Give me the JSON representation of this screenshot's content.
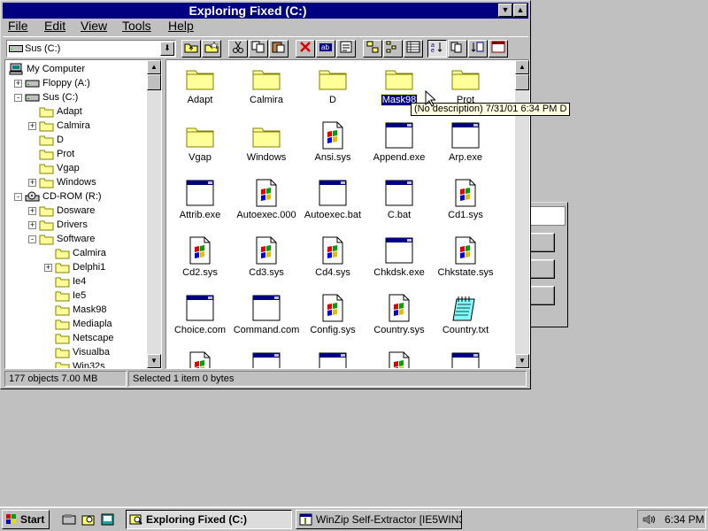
{
  "window": {
    "title": "Exploring Fixed (C:)",
    "menu": [
      "File",
      "Edit",
      "View",
      "Tools",
      "Help"
    ],
    "drive_combo": "Sus (C:)",
    "toolbar_buttons": [
      "up-one-level",
      "map-drive",
      "cut",
      "copy",
      "paste",
      "delete",
      "properties",
      "large-icons",
      "small-icons",
      "list",
      "details",
      "sort-name",
      "sort-type",
      "sort-size",
      "sort-date"
    ]
  },
  "tree": [
    {
      "label": "My Computer",
      "level": 0,
      "icon": "computer-icon",
      "toggle": ""
    },
    {
      "label": "Floppy (A:)",
      "level": 1,
      "icon": "floppy-drive-icon",
      "toggle": "+"
    },
    {
      "label": "Sus (C:)",
      "level": 1,
      "icon": "hard-drive-icon",
      "toggle": "-"
    },
    {
      "label": "Adapt",
      "level": 2,
      "icon": "folder-icon",
      "toggle": ""
    },
    {
      "label": "Calmira",
      "level": 2,
      "icon": "folder-icon",
      "toggle": "+"
    },
    {
      "label": "D",
      "level": 2,
      "icon": "folder-icon",
      "toggle": ""
    },
    {
      "label": "Prot",
      "level": 2,
      "icon": "folder-icon",
      "toggle": ""
    },
    {
      "label": "Vgap",
      "level": 2,
      "icon": "folder-icon",
      "toggle": ""
    },
    {
      "label": "Windows",
      "level": 2,
      "icon": "folder-icon",
      "toggle": "+"
    },
    {
      "label": "CD-ROM (R:)",
      "level": 1,
      "icon": "cdrom-icon",
      "toggle": "-"
    },
    {
      "label": "Dosware",
      "level": 2,
      "icon": "folder-icon",
      "toggle": "+"
    },
    {
      "label": "Drivers",
      "level": 2,
      "icon": "folder-icon",
      "toggle": "+"
    },
    {
      "label": "Software",
      "level": 2,
      "icon": "folder-icon",
      "toggle": "-"
    },
    {
      "label": "Calmira",
      "level": 3,
      "icon": "folder-icon",
      "toggle": ""
    },
    {
      "label": "Delphi1",
      "level": 3,
      "icon": "folder-icon",
      "toggle": "+"
    },
    {
      "label": "Ie4",
      "level": 3,
      "icon": "folder-icon",
      "toggle": ""
    },
    {
      "label": "Ie5",
      "level": 3,
      "icon": "folder-icon",
      "toggle": ""
    },
    {
      "label": "Mask98",
      "level": 3,
      "icon": "folder-icon",
      "toggle": ""
    },
    {
      "label": "Mediapla",
      "level": 3,
      "icon": "folder-icon",
      "toggle": ""
    },
    {
      "label": "Netscape",
      "level": 3,
      "icon": "folder-icon",
      "toggle": ""
    },
    {
      "label": "Visualba",
      "level": 3,
      "icon": "folder-icon",
      "toggle": ""
    },
    {
      "label": "Win32s",
      "level": 3,
      "icon": "folder-icon",
      "toggle": ""
    }
  ],
  "files": [
    {
      "name": "Adapt",
      "type": "folder"
    },
    {
      "name": "Calmira",
      "type": "folder"
    },
    {
      "name": "D",
      "type": "folder"
    },
    {
      "name": "Mask98",
      "type": "folder",
      "selected": true
    },
    {
      "name": "Prot",
      "type": "folder"
    },
    {
      "name": "Vgap",
      "type": "folder"
    },
    {
      "name": "Windows",
      "type": "folder"
    },
    {
      "name": "Ansi.sys",
      "type": "sys"
    },
    {
      "name": "Append.exe",
      "type": "exe"
    },
    {
      "name": "Arp.exe",
      "type": "exe"
    },
    {
      "name": "Attrib.exe",
      "type": "exe"
    },
    {
      "name": "Autoexec.000",
      "type": "sys"
    },
    {
      "name": "Autoexec.bat",
      "type": "exe"
    },
    {
      "name": "C.bat",
      "type": "exe"
    },
    {
      "name": "Cd1.sys",
      "type": "sys"
    },
    {
      "name": "Cd2.sys",
      "type": "sys"
    },
    {
      "name": "Cd3.sys",
      "type": "sys"
    },
    {
      "name": "Cd4.sys",
      "type": "sys"
    },
    {
      "name": "Chkdsk.exe",
      "type": "exe"
    },
    {
      "name": "Chkstate.sys",
      "type": "sys"
    },
    {
      "name": "Choice.com",
      "type": "exe"
    },
    {
      "name": "Command.com",
      "type": "exe"
    },
    {
      "name": "Config.sys",
      "type": "sys"
    },
    {
      "name": "Country.sys",
      "type": "sys"
    },
    {
      "name": "Country.txt",
      "type": "txt"
    },
    {
      "name": "",
      "type": "sys"
    },
    {
      "name": "",
      "type": "exe"
    },
    {
      "name": "",
      "type": "exe"
    },
    {
      "name": "",
      "type": "sys"
    },
    {
      "name": "",
      "type": "exe"
    }
  ],
  "tooltip": "(No description)  7/31/01  6:34 PM  D",
  "status": {
    "objects": "177 objects  7.00 MB",
    "selection": "Selected 1 item  0 bytes"
  },
  "taskbar": {
    "start": "Start",
    "tasks": [
      "Exploring Fixed (C:)",
      "WinZip Self-Extractor [IE5WIN31..."
    ],
    "clock": "6:34 PM"
  },
  "colors": {
    "titlebar": "#000080",
    "desktop": "#c0c0c0",
    "folder": "#ffff99",
    "selection": "#000080"
  }
}
